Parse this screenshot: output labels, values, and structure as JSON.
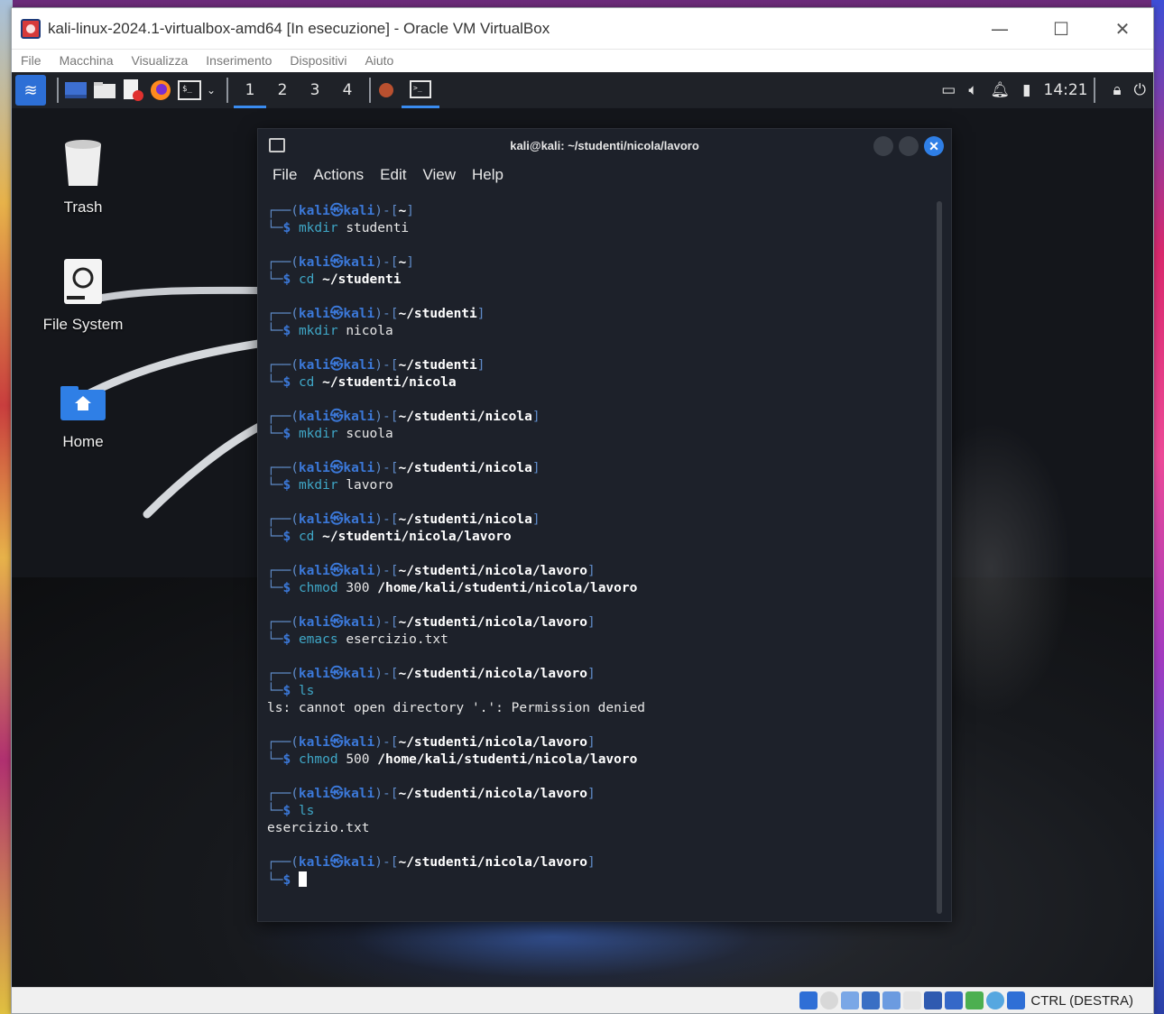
{
  "window": {
    "title": "kali-linux-2024.1-virtualbox-amd64 [In esecuzione] - Oracle VM VirtualBox",
    "controls": {
      "minimize": "—",
      "maximize": "☐",
      "close": "✕"
    }
  },
  "vbox_menu": [
    "File",
    "Macchina",
    "Visualizza",
    "Inserimento",
    "Dispositivi",
    "Aiuto"
  ],
  "panel": {
    "workspaces": [
      "1",
      "2",
      "3",
      "4"
    ],
    "clock": "14:21"
  },
  "desktop": {
    "icons": [
      {
        "label": "Trash"
      },
      {
        "label": "File System"
      },
      {
        "label": "Home"
      }
    ]
  },
  "terminal": {
    "title": "kali@kali: ~/studenti/nicola/lavoro",
    "menu": [
      "File",
      "Actions",
      "Edit",
      "View",
      "Help"
    ],
    "user": "kali",
    "host": "kali",
    "blocks": [
      {
        "path": "~",
        "cmd": "mkdir",
        "args": "studenti",
        "bold_args": false,
        "output": []
      },
      {
        "path": "~",
        "cmd": "cd",
        "args": "~/studenti",
        "bold_args": true,
        "output": []
      },
      {
        "path": "~/studenti",
        "cmd": "mkdir",
        "args": "nicola",
        "bold_args": false,
        "output": []
      },
      {
        "path": "~/studenti",
        "cmd": "cd",
        "args": "~/studenti/nicola",
        "bold_args": true,
        "output": []
      },
      {
        "path": "~/studenti/nicola",
        "cmd": "mkdir",
        "args": "scuola",
        "bold_args": false,
        "output": []
      },
      {
        "path": "~/studenti/nicola",
        "cmd": "mkdir",
        "args": "lavoro",
        "bold_args": false,
        "output": []
      },
      {
        "path": "~/studenti/nicola",
        "cmd": "cd",
        "args": "~/studenti/nicola/lavoro",
        "bold_args": true,
        "output": []
      },
      {
        "path": "~/studenti/nicola/lavoro",
        "cmd": "chmod",
        "args": "300",
        "args2": "/home/kali/studenti/nicola/lavoro",
        "bold_args": false,
        "output": []
      },
      {
        "path": "~/studenti/nicola/lavoro",
        "cmd": "emacs",
        "args": "esercizio.txt",
        "bold_args": false,
        "output": []
      },
      {
        "path": "~/studenti/nicola/lavoro",
        "cmd": "ls",
        "args": "",
        "bold_args": false,
        "output": [
          "ls: cannot open directory '.': Permission denied"
        ]
      },
      {
        "path": "~/studenti/nicola/lavoro",
        "cmd": "chmod",
        "args": "500",
        "args2": "/home/kali/studenti/nicola/lavoro",
        "bold_args": false,
        "output": []
      },
      {
        "path": "~/studenti/nicola/lavoro",
        "cmd": "ls",
        "args": "",
        "bold_args": false,
        "output": [
          "esercizio.txt"
        ]
      },
      {
        "path": "~/studenti/nicola/lavoro",
        "cmd": "",
        "args": "",
        "bold_args": false,
        "output": [],
        "cursor": true
      }
    ]
  },
  "statusbar": {
    "hostkey": "CTRL (DESTRA)"
  }
}
